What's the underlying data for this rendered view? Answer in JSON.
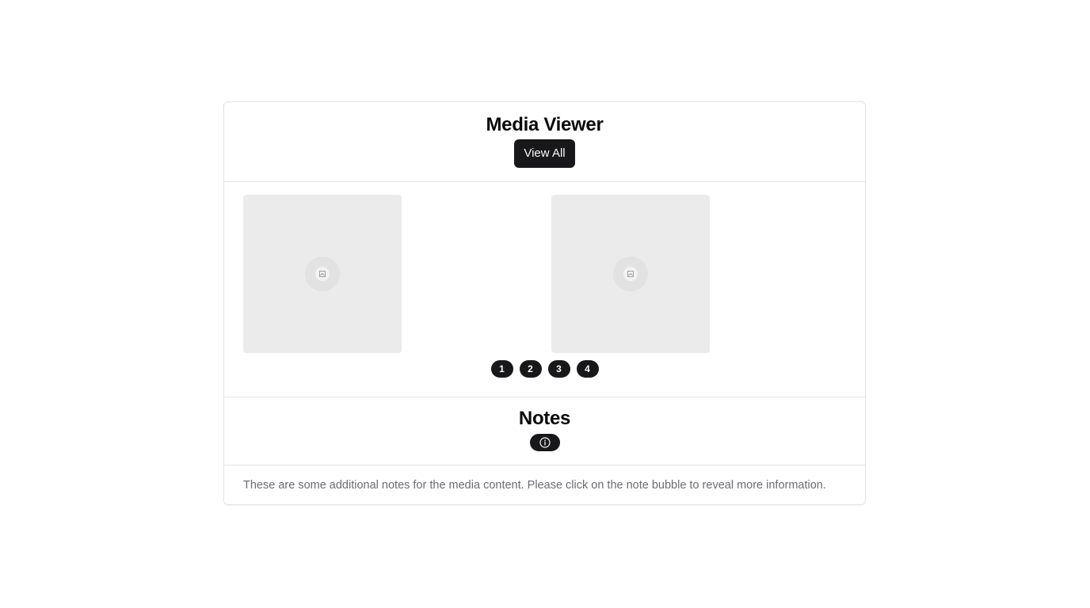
{
  "header": {
    "title": "Media Viewer",
    "view_all_label": "View All"
  },
  "media": {
    "tiles": [
      {
        "icon": "image-placeholder-icon"
      },
      {
        "icon": "image-placeholder-icon"
      }
    ],
    "pages": [
      "1",
      "2",
      "3",
      "4"
    ]
  },
  "notes": {
    "title": "Notes",
    "bubble_icon": "info-icon",
    "text": "These are some additional notes for the media content. Please click on the note bubble to reveal more information."
  },
  "colors": {
    "primary": "#18181b",
    "border": "#e4e4e7",
    "placeholder": "#ebebeb",
    "muted_text": "#6b6b73"
  }
}
